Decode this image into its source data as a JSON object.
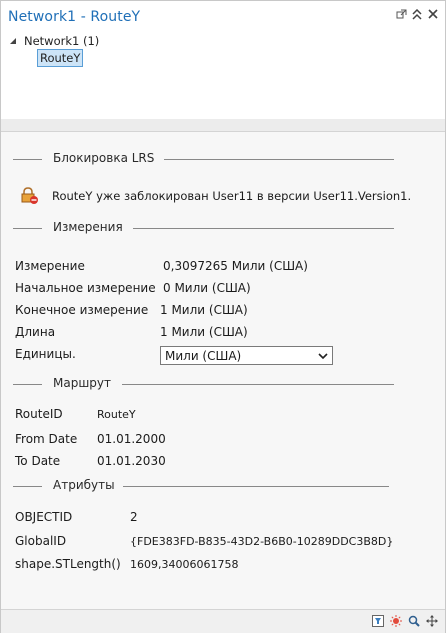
{
  "window": {
    "title": "Network1 - RouteY",
    "icons": [
      "pin-icon",
      "collapse-icon",
      "close-icon"
    ]
  },
  "tree": {
    "root_label": "Network1 (1)",
    "selected_child": "RouteY"
  },
  "lrs_lock": {
    "heading": "Блокировка LRS",
    "message": "RouteY уже заблокирован User11 в версии User11.Version1."
  },
  "measures": {
    "heading": "Измерения",
    "rows": [
      {
        "label": "Измерение",
        "value": "0,3097265 Мили (США)"
      },
      {
        "label": "Начальное измерение",
        "value": "0 Мили (США)"
      },
      {
        "label": "Конечное измерение",
        "value": "1 Мили (США)"
      },
      {
        "label": "Длина",
        "value": "1 Мили (США)"
      }
    ],
    "units_label": "Единицы.",
    "units_value": "Мили (США)"
  },
  "route": {
    "heading": "Маршрут",
    "rows": [
      {
        "label": "RouteID",
        "value": "RouteY"
      },
      {
        "label": "From Date",
        "value": "01.01.2000"
      },
      {
        "label": "To Date",
        "value": "01.01.2030"
      }
    ]
  },
  "attributes": {
    "heading": "Атрибуты",
    "rows": [
      {
        "label": "OBJECTID",
        "value": "2"
      },
      {
        "label": "GlobalID",
        "value": "{FDE383FD-B835-43D2-B6B0-10289DDC3B8D}"
      },
      {
        "label": "shape.STLength()",
        "value": "1609,34006061758"
      }
    ]
  },
  "footer": {
    "icons": [
      "filter-icon",
      "flash-icon",
      "zoom-icon",
      "pan-icon"
    ]
  },
  "colors": {
    "title": "#1f6fb7",
    "selection_bg": "#cde4f7",
    "selection_border": "#5a9ed6"
  }
}
